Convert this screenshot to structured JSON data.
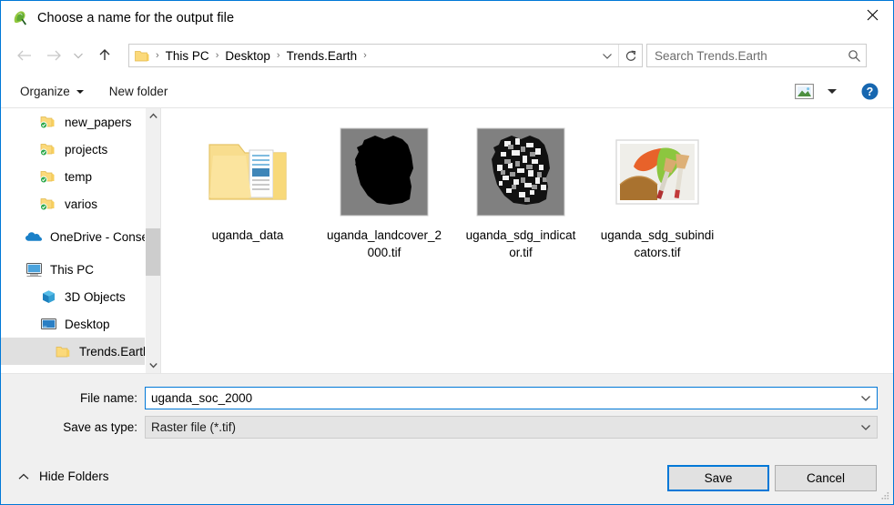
{
  "window": {
    "title": "Choose a name for the output file",
    "icon": "qgis-logo-icon",
    "close_label": "✕"
  },
  "navigation": {
    "back_label": "←",
    "forward_label": "→",
    "recent_label": "⌄",
    "up_label": "↑",
    "refresh_label": "↻",
    "breadcrumbs": [
      "This PC",
      "Desktop",
      "Trends.Earth"
    ],
    "separator": "›"
  },
  "search": {
    "placeholder": "Search Trends.Earth",
    "icon": "search-icon"
  },
  "toolbar": {
    "organize_label": "Organize",
    "new_folder_label": "New folder",
    "view_mode_icon": "picture-view-icon",
    "help_label": "?"
  },
  "sidebar": {
    "items": [
      {
        "label": "new_papers",
        "icon": "folder-synced-icon",
        "indent": 2,
        "selected": false
      },
      {
        "label": "projects",
        "icon": "folder-synced-icon",
        "indent": 2,
        "selected": false
      },
      {
        "label": "temp",
        "icon": "folder-synced-icon",
        "indent": 2,
        "selected": false
      },
      {
        "label": "varios",
        "icon": "folder-synced-icon",
        "indent": 2,
        "selected": false
      },
      {
        "label": "OneDrive - Conse",
        "icon": "onedrive-cloud-icon",
        "indent": 0,
        "selected": false
      },
      {
        "label": "This PC",
        "icon": "computer-icon",
        "indent": 0,
        "selected": false
      },
      {
        "label": "3D Objects",
        "icon": "cube-icon",
        "indent": 1,
        "selected": false
      },
      {
        "label": "Desktop",
        "icon": "desktop-monitor-icon",
        "indent": 1,
        "selected": false
      },
      {
        "label": "Trends.Earth",
        "icon": "folder-icon",
        "indent": 2,
        "selected": true
      }
    ],
    "scroll_up_label": "⌃",
    "scroll_down_label": "⌄"
  },
  "files": [
    {
      "name": "uganda_data",
      "thumb": "folder-documents-icon"
    },
    {
      "name": "uganda_landcover_2000.tif",
      "thumb": "uganda-silhouette-thumb"
    },
    {
      "name": "uganda_sdg_indicator.tif",
      "thumb": "uganda-noise-thumb"
    },
    {
      "name": "uganda_sdg_subindicators.tif",
      "thumb": "paint-picture-thumb"
    }
  ],
  "form": {
    "file_name_label": "File name:",
    "file_name_value": "uganda_soc_2000",
    "save_as_type_label": "Save as type:",
    "save_as_type_value": "Raster file (*.tif)",
    "hide_folders_label": "Hide Folders",
    "hide_folders_caret": "⌃"
  },
  "buttons": {
    "save_label": "Save",
    "cancel_label": "Cancel"
  },
  "colors": {
    "accent": "#0078d7",
    "window_bg": "#ffffff",
    "footer_bg": "#f0f0f0",
    "selection": "#e0e0e0",
    "thumb_bg": "#808080"
  }
}
